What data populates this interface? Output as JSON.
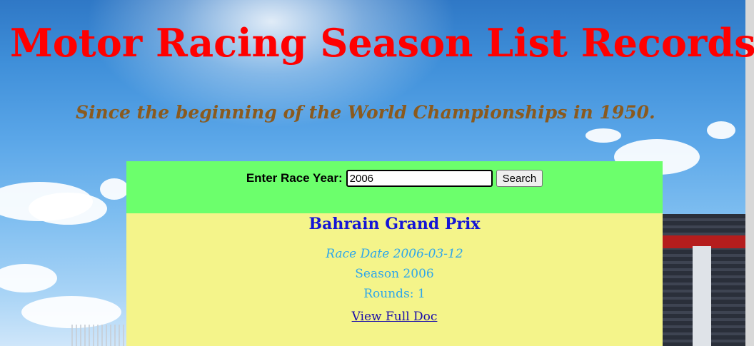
{
  "header": {
    "title": "Motor Racing Season List Records",
    "subtitle": "Since the beginning of the World Championships in 1950."
  },
  "search": {
    "label": "Enter Race Year:",
    "value": "2006",
    "button_label": "Search"
  },
  "result": {
    "race_name": "Bahrain Grand Prix",
    "race_date": "Race Date 2006-03-12",
    "season": "Season 2006",
    "rounds": "Rounds: 1",
    "link_label": "View Full Doc"
  },
  "colors": {
    "title": "#ff0000",
    "subtitle": "#8a5a1e",
    "search_bar_bg": "#6cff6c",
    "result_bg": "#f4f48a",
    "race_name": "#1515d6",
    "details": "#2ea6ea",
    "link": "#1a0dab"
  }
}
